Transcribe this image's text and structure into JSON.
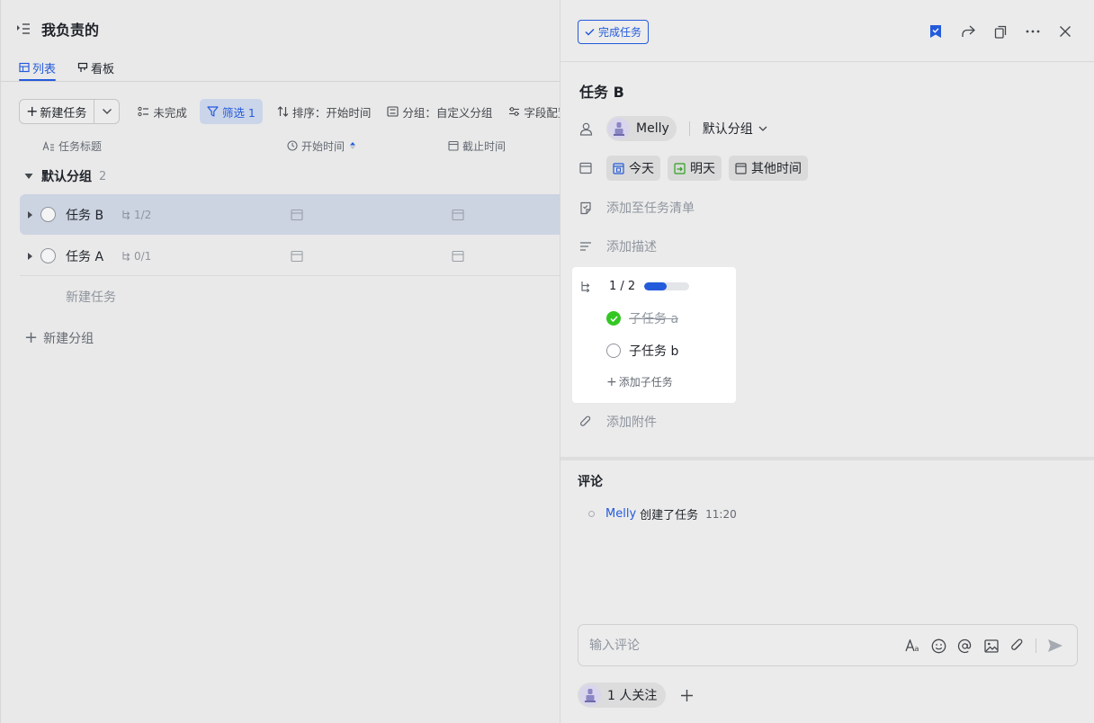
{
  "left": {
    "title": "我负责的",
    "tabs": [
      {
        "label": "列表",
        "icon": "table-icon",
        "active": true
      },
      {
        "label": "看板",
        "icon": "kanban-icon",
        "active": false
      }
    ],
    "toolbar": {
      "new_task": "新建任务",
      "incomplete": "未完成",
      "filter": "筛选 1",
      "sort": "排序：开始时间",
      "group": "分组：自定义分组",
      "fields": "字段配置"
    },
    "columns": {
      "title": "任务标题",
      "start": "开始时间",
      "due": "截止时间"
    },
    "group": {
      "name": "默认分组",
      "count": "2"
    },
    "tasks": [
      {
        "title": "任务 B",
        "subtasks": "1/2",
        "selected": true
      },
      {
        "title": "任务 A",
        "subtasks": "0/1",
        "selected": false
      }
    ],
    "new_task_inline": "新建任务",
    "new_group": "新建分组"
  },
  "detail": {
    "complete_button": "完成任务",
    "title": "任务 B",
    "assignee": "Melly",
    "group_select": "默认分组",
    "dates": {
      "today": "今天",
      "tomorrow": "明天",
      "other": "其他时间"
    },
    "add_to_list": "添加至任务清单",
    "add_description": "添加描述",
    "subtasks": {
      "count": "1 / 2",
      "progress": 0.5,
      "items": [
        {
          "title": "子任务 a",
          "done": true
        },
        {
          "title": "子任务 b",
          "done": false
        }
      ],
      "add_label": "添加子任务"
    },
    "add_attachment": "添加附件",
    "comments": {
      "heading": "评论",
      "items": [
        {
          "user": "Melly",
          "action": "创建了任务",
          "time": "11:20"
        }
      ],
      "input_placeholder": "输入评论"
    },
    "followers": "1 人关注"
  },
  "colors": {
    "accent": "#245bdb",
    "done_green": "#34c724"
  }
}
